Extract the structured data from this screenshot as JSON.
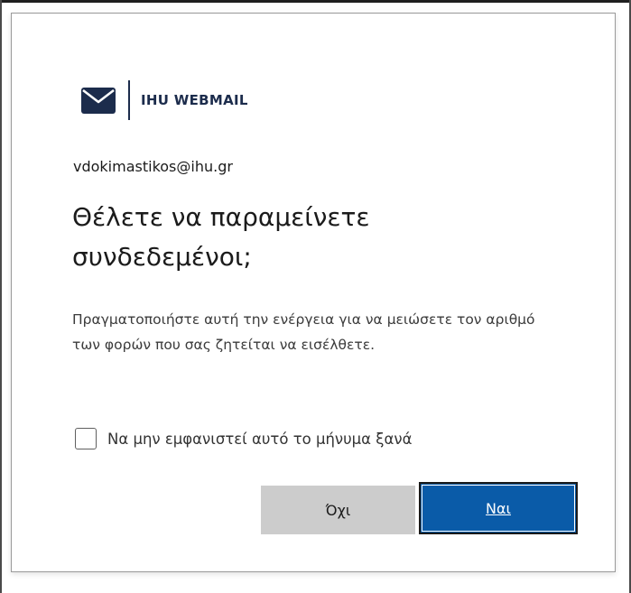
{
  "logo": {
    "icon": "envelope-icon",
    "text": "IHU WEBMAIL",
    "brand_color": "#1c2c4c"
  },
  "account": {
    "email": "vdokimastikos@ihu.gr"
  },
  "prompt": {
    "title": "Θέλετε να παραμείνετε συνδεδεμένοι;",
    "description": "Πραγματοποιήστε αυτή την ενέργεια για να μειώσετε τον αριθμό των φορών που σας ζητείται να εισέλθετε."
  },
  "checkbox": {
    "label": "Να μην εμφανιστεί αυτό το μήνυμα ξανά",
    "checked": false
  },
  "buttons": {
    "no_label": "Όχι",
    "yes_label": "Ναι",
    "primary_color": "#0a5ba8",
    "secondary_color": "#cccccc"
  }
}
